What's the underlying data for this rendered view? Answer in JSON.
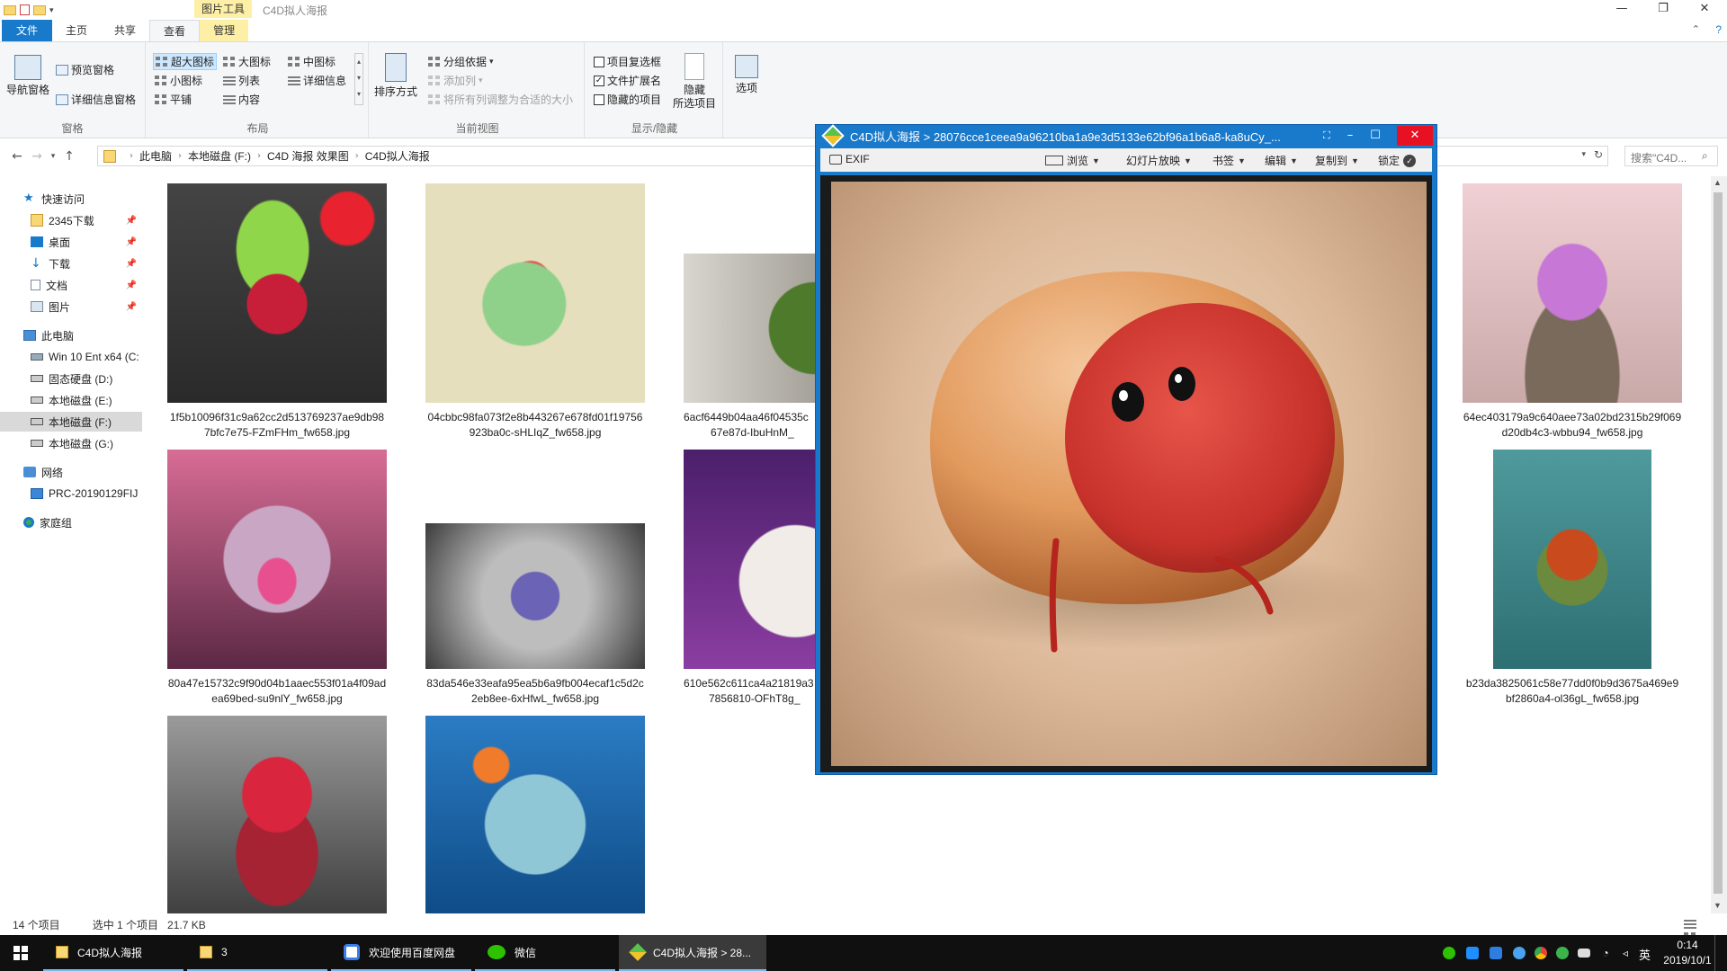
{
  "titlebar": {
    "tool_tab": "图片工具",
    "title": "C4D拟人海报",
    "minimize": "—",
    "restore": "❐",
    "close": "✕"
  },
  "ribbon_tabs": [
    "文件",
    "主页",
    "共享",
    "查看",
    "管理"
  ],
  "ribbon": {
    "pane_group": {
      "nav_pane": "导航窗格",
      "preview_pane": "预览窗格",
      "details_pane": "详细信息窗格",
      "label": "窗格"
    },
    "layout_group": {
      "items": [
        "超大图标",
        "大图标",
        "中图标",
        "小图标",
        "列表",
        "详细信息",
        "平铺",
        "内容"
      ],
      "label": "布局"
    },
    "current_view_group": {
      "sort_by": "排序方式",
      "group_by": "分组依据",
      "add_columns": "添加列",
      "fit_columns": "将所有列调整为合适的大小",
      "label": "当前视图"
    },
    "show_hide_group": {
      "item_checkboxes": "项目复选框",
      "file_extensions": "文件扩展名",
      "hidden_items": "隐藏的项目",
      "hide_selected_1": "隐藏",
      "hide_selected_2": "所选项目",
      "label": "显示/隐藏"
    },
    "options": "选项"
  },
  "address": {
    "crumbs": [
      "此电脑",
      "本地磁盘 (F:)",
      "C4D 海报 效果图",
      "C4D拟人海报"
    ],
    "search_placeholder": "搜索\"C4D..."
  },
  "nav_pane": {
    "items": [
      {
        "label": "快速访问",
        "icon": "star-icon"
      },
      {
        "label": "2345下载",
        "icon": "folder-icon"
      },
      {
        "label": "桌面",
        "icon": "desktop-icon"
      },
      {
        "label": "下载",
        "icon": "download-icon"
      },
      {
        "label": "文档",
        "icon": "document-icon"
      },
      {
        "label": "图片",
        "icon": "pictures-icon"
      },
      {
        "label": "此电脑",
        "icon": "computer-icon"
      },
      {
        "label": "Win 10 Ent x64 (C:",
        "icon": "drive-icon"
      },
      {
        "label": "固态硬盘 (D:)",
        "icon": "drive-icon"
      },
      {
        "label": "本地磁盘 (E:)",
        "icon": "drive-icon"
      },
      {
        "label": "本地磁盘 (F:)",
        "icon": "drive-icon"
      },
      {
        "label": "本地磁盘 (G:)",
        "icon": "drive-icon"
      },
      {
        "label": "网络",
        "icon": "network-icon"
      },
      {
        "label": "PRC-20190129FIJ",
        "icon": "pc-icon"
      },
      {
        "label": "家庭组",
        "icon": "homegroup-icon"
      }
    ]
  },
  "files": [
    {
      "line1": "1f5b10096f31c9a62cc2d513769237ae9db98",
      "line2": "7bfc7e75-FZmFHm_fw658.jpg"
    },
    {
      "line1": "04cbbc98fa073f2e8b443267e678fd01f19756",
      "line2": "923ba0c-sHLIqZ_fw658.jpg"
    },
    {
      "line1": "6acf6449b04aa46f04535c",
      "line2": "67e87d-IbuHnM_"
    },
    {
      "line1": "64ec403179a9c640aee73a02bd2315b29f069",
      "line2": "d20db4c3-wbbu94_fw658.jpg"
    },
    {
      "line1": "80a47e15732c9f90d04b1aaec553f01a4f09ad",
      "line2": "ea69bed-su9nlY_fw658.jpg"
    },
    {
      "line1": "83da546e33eafa95ea5b6a9fb004ecaf1c5d2c",
      "line2": "2eb8ee-6xHfwL_fw658.jpg"
    },
    {
      "line1": "610e562c611ca4a21819a3",
      "line2": "7856810-OFhT8g_"
    },
    {
      "line1": "b23da3825061c58e77dd0f0b9d3675a469e9",
      "line2": "bf2860a4-ol36gL_fw658.jpg"
    }
  ],
  "statusbar": {
    "count": "14 个项目",
    "selected": "选中 1 个项目",
    "size": "21.7 KB"
  },
  "viewer": {
    "title": "C4D拟人海报 > 28076cce1ceea9a96210ba1a9e3d5133e62bf96a1b6a8-ka8uCy_...",
    "toolbar": {
      "exif": "EXIF",
      "browse": "浏览",
      "slideshow": "幻灯片放映",
      "bookmark": "书签",
      "edit": "编辑",
      "copy_to": "复制到",
      "lock": "锁定"
    }
  },
  "taskbar": {
    "items": [
      "C4D拟人海报",
      "3",
      "欢迎使用百度网盘",
      "微信",
      "C4D拟人海报 > 28..."
    ],
    "ime": "英",
    "time": "0:14",
    "date": "2019/10/1"
  }
}
